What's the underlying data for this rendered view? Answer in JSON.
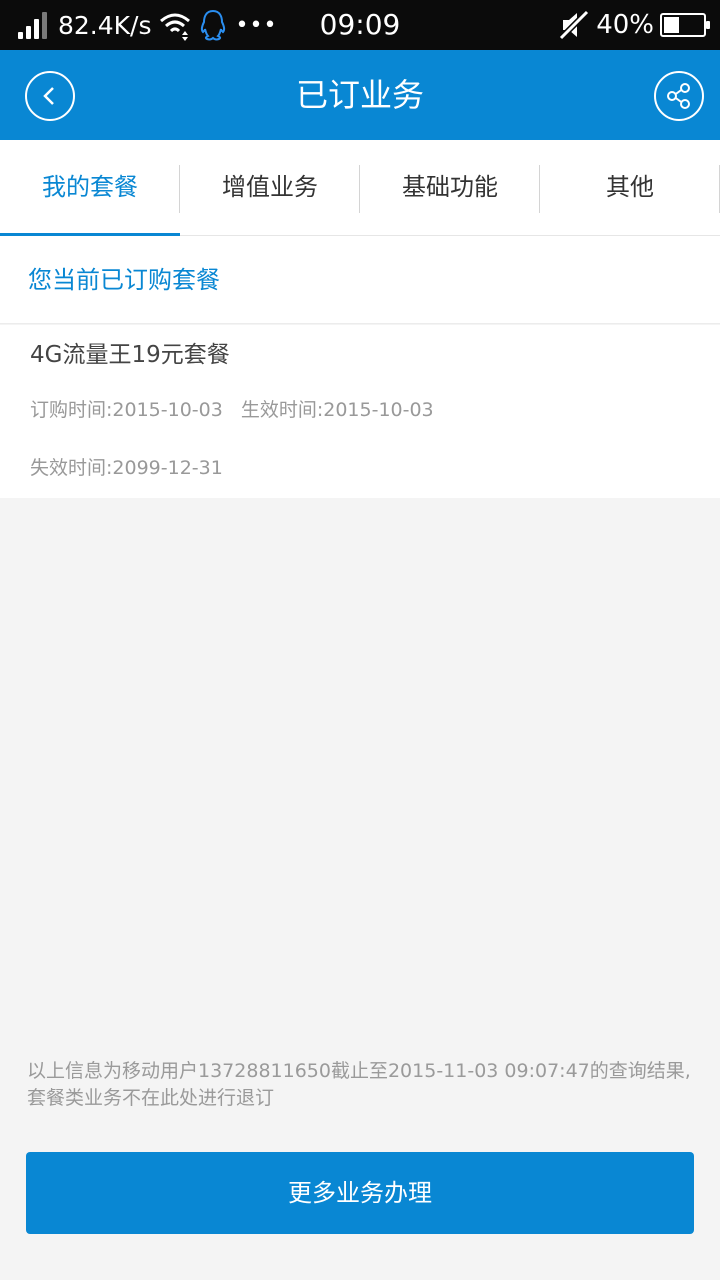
{
  "status_bar": {
    "net_speed": "82.4K/s",
    "time": "09:09",
    "battery_percent": "40%",
    "battery_level": 0.4,
    "more_dots": "•••"
  },
  "header": {
    "title": "已订业务"
  },
  "tabs": [
    {
      "label": "我的套餐",
      "active": true
    },
    {
      "label": "增值业务",
      "active": false
    },
    {
      "label": "基础功能",
      "active": false
    },
    {
      "label": "其他",
      "active": false
    }
  ],
  "section": {
    "title": "您当前已订购套餐"
  },
  "package": {
    "name": "4G流量王19元套餐",
    "order_time": "订购时间:2015-10-03",
    "effective_time": "生效时间:2015-10-03",
    "expire_time": "失效时间:2099-12-31"
  },
  "note": {
    "line1": "以上信息为移动用户13728811650截止至2015-11-03 09:07:47的查询结果,",
    "line2": "套餐类业务不在此处进行退订"
  },
  "actions": {
    "more_label": "更多业务办理"
  },
  "colors": {
    "primary": "#0987d3",
    "background": "#f4f4f4",
    "status_bar": "#0b0b0b"
  }
}
